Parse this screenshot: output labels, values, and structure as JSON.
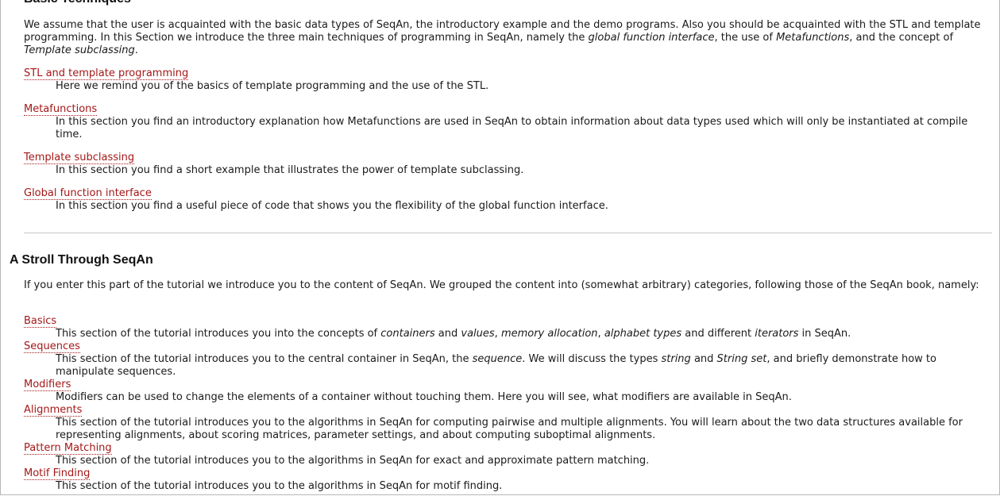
{
  "basic": {
    "heading": "Basic Techniques",
    "intro_1": "We assume that the user is acquainted with the basic data types of SeqAn, the introductory example and the demo programs. Also you should be acquainted with the STL and template programming. In this Section we introduce the three main techniques of programming in SeqAn, namely the ",
    "intro_em_1": "global function interface",
    "intro_2": ", the use of ",
    "intro_em_2": "Metafunctions",
    "intro_3": ", and the concept of ",
    "intro_em_3": "Template subclassing",
    "intro_4": ".",
    "items": [
      {
        "term": "STL and template programming",
        "desc": "Here we remind you of the basics of template programming and the use of the STL."
      },
      {
        "term": "Metafunctions",
        "desc": "In this section you find an introductory explanation how Metafunctions are used in SeqAn to obtain information about data types used which will only be instantiated at compile time."
      },
      {
        "term": "Template subclassing",
        "desc": "In this section you find a short example that illustrates the power of template subclassing."
      },
      {
        "term": "Global function interface",
        "desc": "In this section you find a useful piece of code that shows you the flexibility of the global function interface."
      }
    ]
  },
  "stroll": {
    "heading": "A Stroll Through SeqAn",
    "intro": "If you enter this part of the tutorial we introduce you to the content of SeqAn. We grouped the content into (somewhat arbitrary) categories, following those of the SeqAn book, namely:",
    "basics": {
      "term": "Basics",
      "d1": "This section of the tutorial introduces you into the concepts of ",
      "e1": "containers",
      "d2": " and ",
      "e2": "values",
      "d3": ", ",
      "e3": "memory allocation",
      "d4": ", ",
      "e4": "alphabet types",
      "d5": " and different ",
      "e5": "iterators",
      "d6": " in SeqAn."
    },
    "sequences": {
      "term": "Sequences",
      "d1": "This section of the tutorial introduces you to the central container in SeqAn, the ",
      "e1": "sequence",
      "d2": ". We will discuss the types ",
      "e2": "string",
      "d3": " and ",
      "e3": "String set",
      "d4": ", and briefly demonstrate how to manipulate sequences."
    },
    "modifiers": {
      "term": "Modifiers",
      "desc": "Modifiers can be used to change the elements of a container without touching them. Here you will see, what modifiers are available in SeqAn."
    },
    "alignments": {
      "term": "Alignments",
      "desc": "This section of the tutorial introduces you to the algorithms in SeqAn for computing pairwise and multiple alignments. You will learn about the two data structures available for representing alignments, about scoring matrices, parameter settings, and about computing suboptimal alignments."
    },
    "pattern": {
      "term": "Pattern Matching",
      "desc": "This section of the tutorial introduces you to the algorithms in SeqAn for exact and approximate pattern matching."
    },
    "motif": {
      "term": "Motif Finding",
      "desc": "This section of the tutorial introduces you to the algorithms in SeqAn for motif finding."
    }
  }
}
